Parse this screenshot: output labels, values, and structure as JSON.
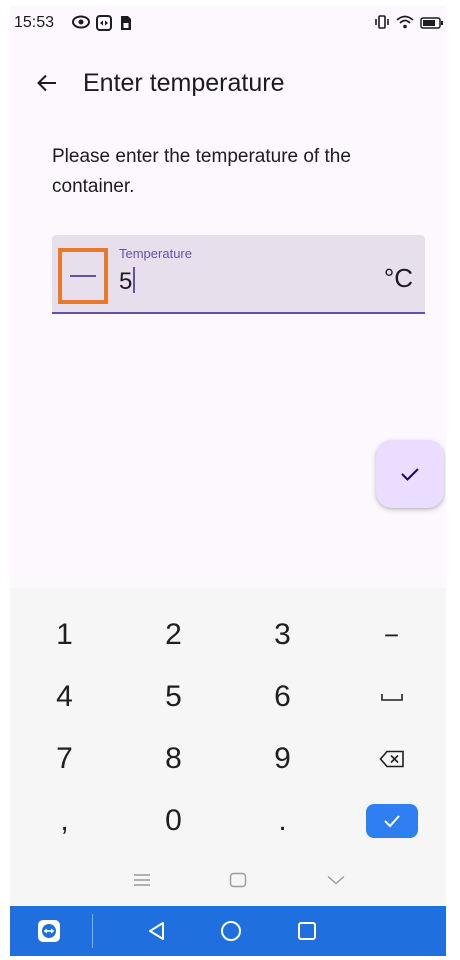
{
  "status_bar": {
    "time": "15:53",
    "left_icons": [
      "eye-icon",
      "teamviewer-icon",
      "sim-card-icon"
    ],
    "right_icons": [
      "vibrate-icon",
      "wifi-icon",
      "battery-icon"
    ]
  },
  "app_bar": {
    "back_icon": "arrow-left-icon",
    "title": "Enter temperature"
  },
  "instruction": "Please enter the temperature of the container.",
  "temperature_field": {
    "label": "Temperature",
    "value": "5",
    "suffix": "°C",
    "sign_toggle_icon": "minus-icon"
  },
  "fab": {
    "icon": "check-icon"
  },
  "keyboard": {
    "rows": [
      [
        "1",
        "2",
        "3",
        "-"
      ],
      [
        "4",
        "5",
        "6",
        "space"
      ],
      [
        "7",
        "8",
        "9",
        "backspace"
      ],
      [
        ",",
        "0",
        ".",
        "done"
      ]
    ],
    "labels": {
      "k1": "1",
      "k2": "2",
      "k3": "3",
      "minus": "−",
      "k4": "4",
      "k5": "5",
      "k6": "6",
      "k7": "7",
      "k8": "8",
      "k9": "9",
      "comma": ",",
      "k0": "0",
      "period": "."
    },
    "nav_icons": [
      "menu-icon",
      "home-square-icon",
      "chevron-down-icon"
    ]
  },
  "system_nav": {
    "icons": [
      "teamviewer-icon",
      "back-triangle-icon",
      "home-circle-icon",
      "recents-square-icon"
    ]
  },
  "colors": {
    "primary": "#6750a4",
    "field_bg": "#e7e0ec",
    "fab_bg": "#eaddff",
    "highlight": "#e8792a",
    "keyboard_done": "#2f7ff2",
    "nav_bar": "#1f6fde"
  }
}
